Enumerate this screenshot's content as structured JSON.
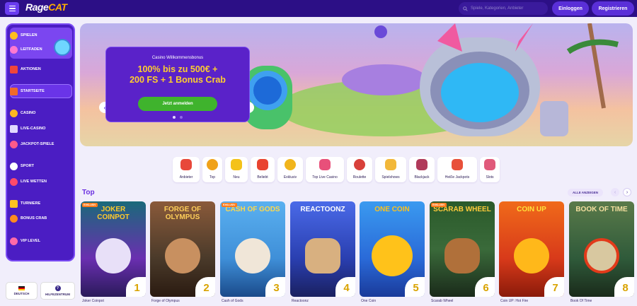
{
  "header": {
    "logo_part1": "Rage",
    "logo_part2": "CAT",
    "search_placeholder": "Spiele, Kategorien, Anbieter",
    "login_label": "Einloggen",
    "register_label": "Registrieren"
  },
  "sidebar": {
    "items": [
      {
        "label": "SPIELEN",
        "icon": "coin-icon"
      },
      {
        "label": "LEITFADEN",
        "icon": "guide-icon"
      },
      {
        "label": "AKTIONEN",
        "icon": "gift-icon"
      },
      {
        "label": "STARTSEITE",
        "icon": "home-icon"
      },
      {
        "label": "CASINO",
        "icon": "casino-icon"
      },
      {
        "label": "LIVE-CASINO",
        "icon": "live-casino-icon"
      },
      {
        "label": "JACKPOT-SPIELE",
        "icon": "jackpot-icon"
      },
      {
        "label": "SPORT",
        "icon": "ball-icon"
      },
      {
        "label": "LIVE WETTEN",
        "icon": "live-bet-icon"
      },
      {
        "label": "TURNIERE",
        "icon": "trophy-icon"
      },
      {
        "label": "BONUS CRAB",
        "icon": "crab-icon"
      },
      {
        "label": "VIP LEVEL",
        "icon": "vip-icon"
      }
    ],
    "language_label": "DEUTSCH",
    "help_label": "HILFEZENTRUM"
  },
  "banner": {
    "subtitle": "Casino Willkommensbonus",
    "headline_line1": "100% bis zu 500€ +",
    "headline_line2": "200 FS + 1 Bonus Crab",
    "cta_label": "Jetzt anmelden",
    "prev_arrow": "‹",
    "next_arrow": "›"
  },
  "categories": [
    {
      "label": "Anbieter",
      "color": "#e8483a"
    },
    {
      "label": "Top",
      "color": "#f0a21a"
    },
    {
      "label": "Neu",
      "color": "#f4c21a"
    },
    {
      "label": "Beliebt",
      "color": "#e94430"
    },
    {
      "label": "Exklusiv",
      "color": "#f1b51c"
    },
    {
      "label": "Top Live Casino",
      "color": "#e8507a"
    },
    {
      "label": "Roulette",
      "color": "#d8403a"
    },
    {
      "label": "Spielshows",
      "color": "#f2b83a"
    },
    {
      "label": "Blackjack",
      "color": "#b03a5a"
    },
    {
      "label": "Heiße Jackpots",
      "color": "#e8503a"
    },
    {
      "label": "Slots",
      "color": "#e05a7a"
    }
  ],
  "top_section": {
    "title": "Top",
    "show_all_label": "ALLE ANZEIGEN",
    "prev": "‹",
    "next": "›"
  },
  "games": [
    {
      "title": "JOKER COINPOT",
      "name": "Joker Coinpot",
      "rank": "1",
      "bg": "#6a2fb0",
      "accent": "#ffcb2a"
    },
    {
      "title": "FORGE OF OLYMPUS",
      "name": "Forge of Olympus",
      "rank": "2",
      "bg": "#4a3a2a",
      "accent": "#ffcf5a"
    },
    {
      "title": "CASH OF GODS",
      "name": "Cash of Gods",
      "rank": "3",
      "bg": "#3f8fd8",
      "accent": "#ffd84a"
    },
    {
      "title": "REACTOONZ",
      "name": "Reactoonz",
      "rank": "4",
      "bg": "#2a3fb0",
      "accent": "#ffffff"
    },
    {
      "title": "ONE COIN",
      "name": "One Coin",
      "rank": "5",
      "bg": "#2a6ad8",
      "accent": "#ffc21a"
    },
    {
      "title": "SCARAB WHEEL",
      "name": "Scarab Wheel",
      "rank": "6",
      "bg": "#3a6a3a",
      "accent": "#ffcc3a"
    },
    {
      "title": "COIN UP",
      "name": "Coin UP: Hot Fire",
      "rank": "7",
      "bg": "#d83a1a",
      "accent": "#ffe23a"
    },
    {
      "title": "BOOK OF TIME",
      "name": "Book Of Time",
      "rank": "8",
      "bg": "#2f5a3a",
      "accent": "#f4e0a0"
    }
  ],
  "hot_badge": "EXKLUSIV",
  "colors": {
    "brand_purple": "#2c0f86",
    "accent_purple": "#5a2fd8",
    "cta_green": "#3fb32d",
    "bonus_yellow": "#ffce2e"
  }
}
